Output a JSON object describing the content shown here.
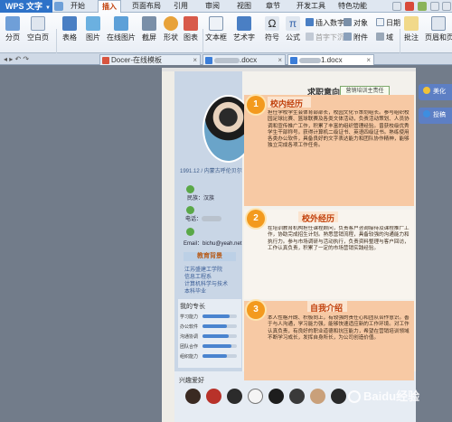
{
  "app": {
    "name": "WPS 文字"
  },
  "menu_tabs": [
    "开始",
    "插入",
    "页面布局",
    "引用",
    "审阅",
    "视图",
    "章节",
    "开发工具",
    "特色功能"
  ],
  "active_menu_tab": "插入",
  "ribbon": {
    "big_buttons": [
      "分页",
      "空白页",
      "表格",
      "图片",
      "在线图片",
      "截屏",
      "形状",
      "图表",
      "文本框",
      "艺术字",
      "符号",
      "公式"
    ],
    "insert_number": "插入数字",
    "object": "对象",
    "first_char": "首字下沉",
    "attachment": "附件",
    "date": "日期",
    "field": "域",
    "comment": "批注",
    "page_header_footer": "页眉和页脚"
  },
  "doc_tabs": [
    {
      "label": "Docer-在线模板",
      "active": false
    },
    {
      "label": ".docx",
      "active": false
    },
    {
      "label": "1.docx",
      "active": true
    }
  ],
  "resume": {
    "job_label": "求职意向",
    "job_value": "营销培训主责任",
    "birth": "1991.12 / 内蒙古呼伦贝尔",
    "contacts": [
      {
        "icon": "person-icon",
        "text": "民族：汉族"
      },
      {
        "icon": "phone-icon",
        "text": "电话："
      },
      {
        "icon": "email-icon",
        "text": "Email：bichu@yeah.net"
      }
    ],
    "education_title": "教育背景",
    "education": [
      "江苏盛建工学院",
      "信息工程系",
      "计算机科学与技术",
      "本科毕业"
    ],
    "skills_title": "我的专长",
    "skills": [
      {
        "label": "学习能力",
        "level": 0.8
      },
      {
        "label": "办公软件",
        "level": 0.7
      },
      {
        "label": "沟通协调",
        "level": 0.75
      },
      {
        "label": "团队合作",
        "level": 0.85
      },
      {
        "label": "组织能力",
        "level": 0.7
      }
    ],
    "hobby_title": "兴趣爱好",
    "sections": [
      {
        "num": "1",
        "title": "校内经历",
        "text": "担任学校学生会体育部部长，校园文化节策划组长。参与组织校园足球比赛、篮球联赛及各类文体活动，负责活动策划、人员协调和宣传推广工作，积累了丰富的组织管理经验。曾获校级优秀学生干部称号。获得计算机二级证书、英语四级证书。熟练使用各类办公软件，具备良好的文字表达能力和团队协作精神，能够独立完成各项工作任务。"
      },
      {
        "num": "2",
        "title": "校外经历",
        "text": "在培训教育机构担任课程顾问，负责客户咨询接待及课程推广工作，协助完成招生计划。熟悉营销流程，具备较强的沟通能力和执行力。参与市场调研与活动执行，负责资料整理与客户回访，工作认真负责，积累了一定的市场营销实践经验。"
      },
      {
        "num": "3",
        "title": "自我介绍",
        "text": "本人性格开朗、积极向上，有较强的责任心和团队合作意识。善于与人沟通，学习能力强，能够快速适应新的工作环境。对工作认真负责，有良好的职业道德和抗压能力，希望在营销培训领域不断学习成长，发挥自身所长，为公司创造价值。"
      }
    ]
  },
  "side_buttons": [
    "美化",
    "投稿"
  ],
  "watermark": "Baidu经验",
  "colors": {
    "accent_orange": "#f39a1e",
    "title_orange": "#c2410c",
    "section_bg": "#f7c9a4",
    "app_blue": "#2e72c8"
  }
}
